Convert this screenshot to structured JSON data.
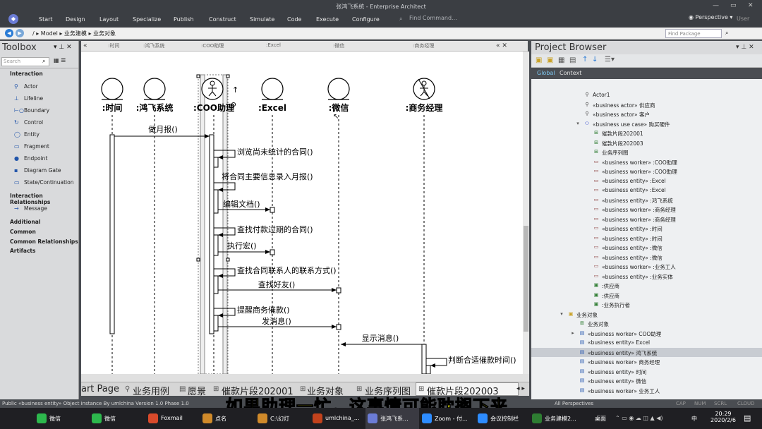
{
  "window": {
    "title": "张鸿飞系统 - Enterprise Architect"
  },
  "menu": {
    "items": [
      "Start",
      "Design",
      "Layout",
      "Specialize",
      "Publish",
      "Construct",
      "Simulate",
      "Code",
      "Execute",
      "Configure"
    ],
    "find_command_placeholder": "Find Command...",
    "perspective_label": "Perspective",
    "user_label": "User"
  },
  "breadcrumb": {
    "path": "/   ▸ Model ▸ 业务建模 ▸ 业务对象",
    "find_package_placeholder": "Find Package"
  },
  "toolbox": {
    "title": "Toolbox",
    "search_placeholder": "Search",
    "sections": [
      {
        "label": "Interaction",
        "items": [
          "Actor",
          "Lifeline",
          "Boundary",
          "Control",
          "Entity",
          "Fragment",
          "Endpoint",
          "Diagram Gate",
          "State/Continuation"
        ]
      },
      {
        "label": "Interaction Relationships",
        "items": [
          "Message"
        ]
      },
      {
        "label": "Additional",
        "items": []
      },
      {
        "label": "Common",
        "items": []
      },
      {
        "label": "Common Relationships",
        "items": []
      },
      {
        "label": "Artifacts",
        "items": []
      }
    ]
  },
  "diagram_header_tabs": [
    ":时间",
    ":鸿飞系统",
    ":COO助理",
    ":Excel",
    ":微信",
    ":商务经理"
  ],
  "diagram": {
    "lifelines": [
      ":时间",
      ":鸿飞系统",
      ":COO助理",
      ":Excel",
      ":微信",
      ":商务经理"
    ],
    "messages": [
      "做月报()",
      "浏览尚未统计的合同()",
      "将合同主要信息录入月报()",
      "编辑文档()",
      "查找付款过期的合同()",
      "执行宏()",
      "查找合同联系人的联系方式()",
      "查找好友()",
      "提醒商务催款()",
      "发消息()",
      "显示消息()",
      "判断合适催款时间()"
    ]
  },
  "document_tabs": [
    "art Page",
    "业务用例",
    "愿景",
    "催款片段202001",
    "业务对象",
    "业务序列图",
    "催款片段202003"
  ],
  "project_browser": {
    "title": "Project Browser",
    "tabs": [
      "Global",
      "Context"
    ],
    "items": [
      "Actor1",
      "«business actor» 供应商",
      "«business actor» 客户",
      "«business use case» 购买硬件",
      "催款片段202001",
      "催款片段202003",
      "业务序列图",
      "«business worker» :COO助理",
      "«business worker» :COO助理",
      "«business entity» :Excel",
      "«business entity» :Excel",
      "«business entity» :鸿飞系统",
      "«business worker» :商务经理",
      "«business worker» :商务经理",
      "«business entity» :时间",
      "«business entity» :时间",
      "«business entity» :微信",
      "«business entity» :微信",
      "«business worker» :业务工人",
      "«business entity» :业务实体",
      ":供应商",
      ":供应商",
      ":业务执行者",
      "业务对象",
      "业务对象",
      "«business worker» COO助理",
      "«business entity» Excel",
      "«business entity» 鸿飞系统",
      "«business worker» 商务经理",
      "«business entity» 时间",
      "«business entity» 微信",
      "«business worker» 业务工人"
    ]
  },
  "status": {
    "left": "Public «business entity»  Object instance  By umlchina Version 1.0  Phase 1.0",
    "right": "All Perspectives",
    "flags": [
      "CAP",
      "NUM",
      "SCRL",
      "CLOUD"
    ]
  },
  "subtitle": "如果助理一忙，这事情可能耽搁下来",
  "taskbar": {
    "apps": [
      "微信",
      "微信",
      "Foxmail",
      "点名",
      "C:\\幻灯",
      "umlchina_...",
      "张鸿飞系...",
      "Zoom - 付...",
      "会议控制栏",
      "业务建模2..."
    ],
    "tray_text": "桌面",
    "time": "20:29",
    "date": "2020/2/6",
    "ime": "中"
  }
}
